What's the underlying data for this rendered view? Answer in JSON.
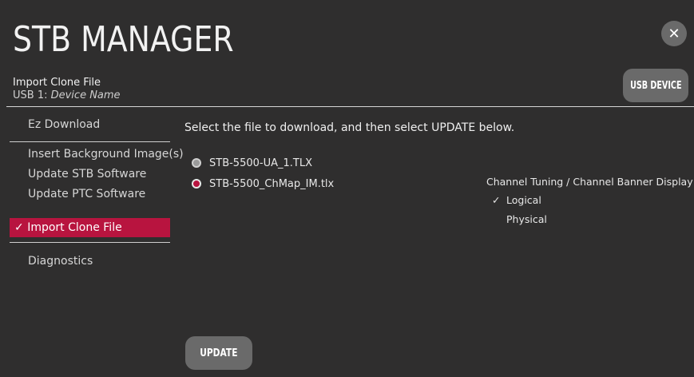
{
  "header": {
    "app_title": "STB MANAGER",
    "subtitle": "Import Clone File",
    "device_prefix": "USB 1: ",
    "device_name": "Device Name",
    "close_label": "✕",
    "usb_button_label": "USB DEVICE"
  },
  "sidebar": {
    "items": [
      {
        "label": "Ez Download"
      },
      {
        "label": "Insert Background Image(s)"
      },
      {
        "label": "Update STB Software"
      },
      {
        "label": "Update PTC Software"
      },
      {
        "label": "Import Clone File",
        "check": "✓"
      },
      {
        "label": "Diagnostics"
      }
    ],
    "active_index": 4
  },
  "main": {
    "instruction": "Select the file to download, and then select UPDATE below.",
    "files": [
      {
        "name": "STB-5500-UA_1.TLX",
        "selected": false
      },
      {
        "name": "STB-5500_ChMap_IM.tlx",
        "selected": true
      }
    ],
    "tuning": {
      "title": "Channel Tuning / Channel Banner Display",
      "options": [
        {
          "label": "Logical",
          "check": "✓",
          "checked": true
        },
        {
          "label": "Physical",
          "check": "",
          "checked": false
        }
      ]
    },
    "update_label": "UPDATE"
  },
  "colors": {
    "background": "#2f2e2e",
    "accent": "#b8143f",
    "button": "#6a6a6a"
  }
}
